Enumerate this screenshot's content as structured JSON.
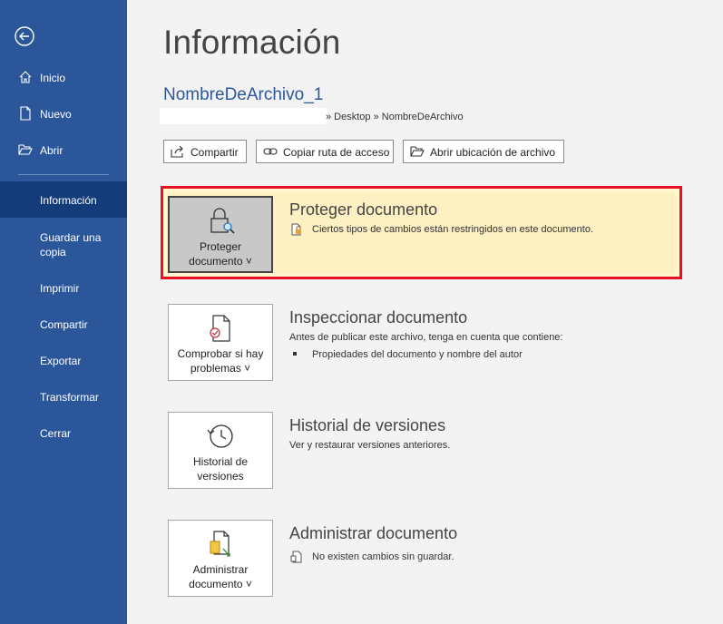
{
  "sidebar": {
    "items": [
      {
        "label": "Inicio",
        "icon": "home-icon"
      },
      {
        "label": "Nuevo",
        "icon": "new-document-icon"
      },
      {
        "label": "Abrir",
        "icon": "open-folder-icon"
      },
      {
        "label": "Información"
      },
      {
        "label": "Guardar una copia"
      },
      {
        "label": "Imprimir"
      },
      {
        "label": "Compartir"
      },
      {
        "label": "Exportar"
      },
      {
        "label": "Transformar"
      },
      {
        "label": "Cerrar"
      }
    ],
    "guardar_line1": "Guardar una",
    "guardar_line2": "copia"
  },
  "main": {
    "title": "Información",
    "filename": "NombreDeArchivo_1",
    "path": "» Desktop » NombreDeArchivo",
    "toolbar": {
      "share": "Compartir",
      "copy_path": "Copiar ruta de acceso",
      "open_location": "Abrir ubicación de archivo"
    },
    "protect": {
      "button_line1": "Proteger",
      "button_line2": "documento ˅",
      "title": "Proteger documento",
      "desc": "Ciertos tipos de cambios están restringidos en este documento."
    },
    "inspect": {
      "button_line1": "Comprobar si hay",
      "button_line2": "problemas ˅",
      "title": "Inspeccionar documento",
      "desc": "Antes de publicar este archivo, tenga en cuenta que contiene:",
      "bullet": "Propiedades del documento y nombre del autor"
    },
    "history": {
      "button_line1": "Historial de",
      "button_line2": "versiones",
      "title": "Historial de versiones",
      "desc": "Ver y restaurar versiones anteriores."
    },
    "manage": {
      "button_line1": "Administrar",
      "button_line2": "documento ˅",
      "title": "Administrar documento",
      "desc": "No existen cambios sin guardar."
    }
  },
  "colors": {
    "sidebar": "#2b579a",
    "sidebar_active": "#143b7a",
    "highlight_border": "#e81123",
    "highlight_bg": "#fdf0c3"
  }
}
